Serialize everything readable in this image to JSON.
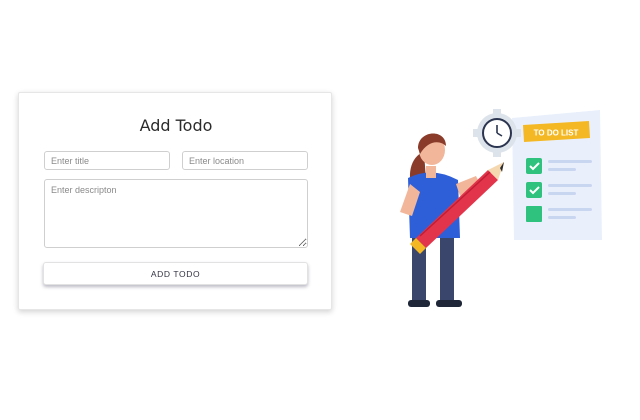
{
  "form": {
    "heading": "Add Todo",
    "title_placeholder": "Enter title",
    "location_placeholder": "Enter location",
    "description_placeholder": "Enter descripton",
    "submit_label": "ADD  TODO"
  },
  "illustration": {
    "list_header": "TO DO LIST",
    "items": [
      {
        "checked": true
      },
      {
        "checked": true
      },
      {
        "checked": false
      }
    ]
  },
  "colors": {
    "accent_yellow": "#f4b824",
    "check_green": "#2ec27e",
    "shirt_blue": "#2f5fd8",
    "pencil_red": "#e2344a"
  }
}
